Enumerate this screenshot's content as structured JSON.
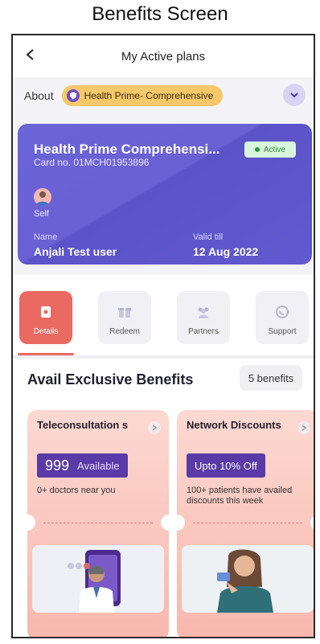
{
  "caption": "Benefits Screen",
  "header": {
    "title": "My Active plans"
  },
  "about": {
    "label": "About",
    "plan_chip": "Health Prime- Comprehensive"
  },
  "card": {
    "title": "Health Prime Comprehensi...",
    "card_no": "Card no. 01MCH01953896",
    "status": "Active",
    "member": "Self",
    "name_label": "Name",
    "name_value": "Anjali Test user",
    "valid_label": "Valid till",
    "valid_value": "12 Aug 2022"
  },
  "tabs": [
    {
      "label": "Details",
      "icon": "details-icon",
      "active": true
    },
    {
      "label": "Redeem",
      "icon": "gift-icon",
      "active": false
    },
    {
      "label": "Partners",
      "icon": "partners-icon",
      "active": false
    },
    {
      "label": "Support",
      "icon": "support-icon",
      "active": false
    }
  ],
  "benefits": {
    "heading": "Avail Exclusive Benefits",
    "count": "5 benefits",
    "items": [
      {
        "title": "Teleconsultation s",
        "pill_num": "999",
        "pill_text": "Available",
        "desc": "0+ doctors near you"
      },
      {
        "title": "Network Discounts",
        "pill_text": "Upto 10% Off",
        "desc": "100+ patients have availed discounts this week"
      }
    ]
  },
  "colors": {
    "card": "#6a61d4",
    "accent": "#ea6a62",
    "chip": "#f7c86a",
    "pill": "#5a3aa6"
  }
}
